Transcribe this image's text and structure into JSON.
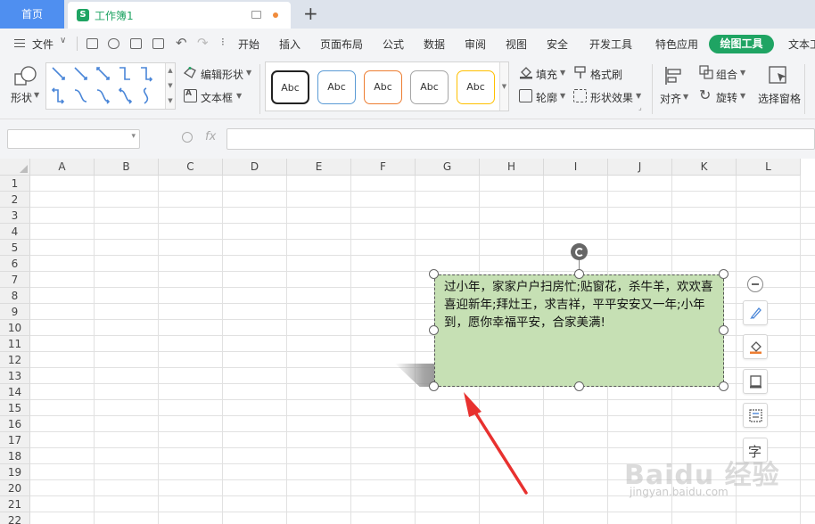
{
  "tabs": {
    "home_label": "首页",
    "doc_label": "工作簿1",
    "doc_icon": "S",
    "new_tab": "+"
  },
  "menu": {
    "file_label": "文件",
    "items": [
      "开始",
      "插入",
      "页面布局",
      "公式",
      "数据",
      "审阅",
      "视图",
      "安全",
      "开发工具",
      "特色应用",
      "绘图工具",
      "文本工"
    ],
    "active_item": "绘图工具",
    "accent_color": "#1fa463"
  },
  "ribbon": {
    "shape_label": "形状",
    "edit_shape_label": "编辑形状",
    "text_box_label": "文本框",
    "style_presets": [
      "Abc",
      "Abc",
      "Abc",
      "Abc",
      "Abc"
    ],
    "style_colors": [
      "#222222",
      "#5b9bd5",
      "#ed7d31",
      "#a5a5a5",
      "#ffc000"
    ],
    "fill_label": "填充",
    "format_painter_label": "格式刷",
    "outline_label": "轮廓",
    "shape_effect_label": "形状效果",
    "align_label": "对齐",
    "group_label": "组合",
    "rotate_label": "旋转",
    "select_pane_label": "选择窗格"
  },
  "formula_bar": {
    "name_box_value": "",
    "fx_label": "fx",
    "formula_value": ""
  },
  "grid": {
    "columns": [
      "A",
      "B",
      "C",
      "D",
      "E",
      "F",
      "G",
      "H",
      "I",
      "J",
      "K",
      "L"
    ],
    "rows": [
      "1",
      "2",
      "3",
      "4",
      "5",
      "6",
      "7",
      "8",
      "9",
      "10",
      "11",
      "12",
      "13",
      "14",
      "15",
      "16",
      "17",
      "18",
      "19",
      "20",
      "21",
      "22"
    ]
  },
  "textbox": {
    "text": "过小年，家家户户扫房忙;贴窗花，杀牛羊，欢欢喜喜迎新年;拜灶王，求吉祥，平平安安又一年;小年到，愿你幸福平安，合家美满!",
    "fill_color": "#c6e0b4"
  },
  "side_tools": {
    "text_label": "字"
  },
  "annotation": {
    "arrow_color": "#e8312f"
  },
  "watermark": {
    "line1": "Baidu 经验",
    "line2": "jingyan.baidu.com"
  }
}
